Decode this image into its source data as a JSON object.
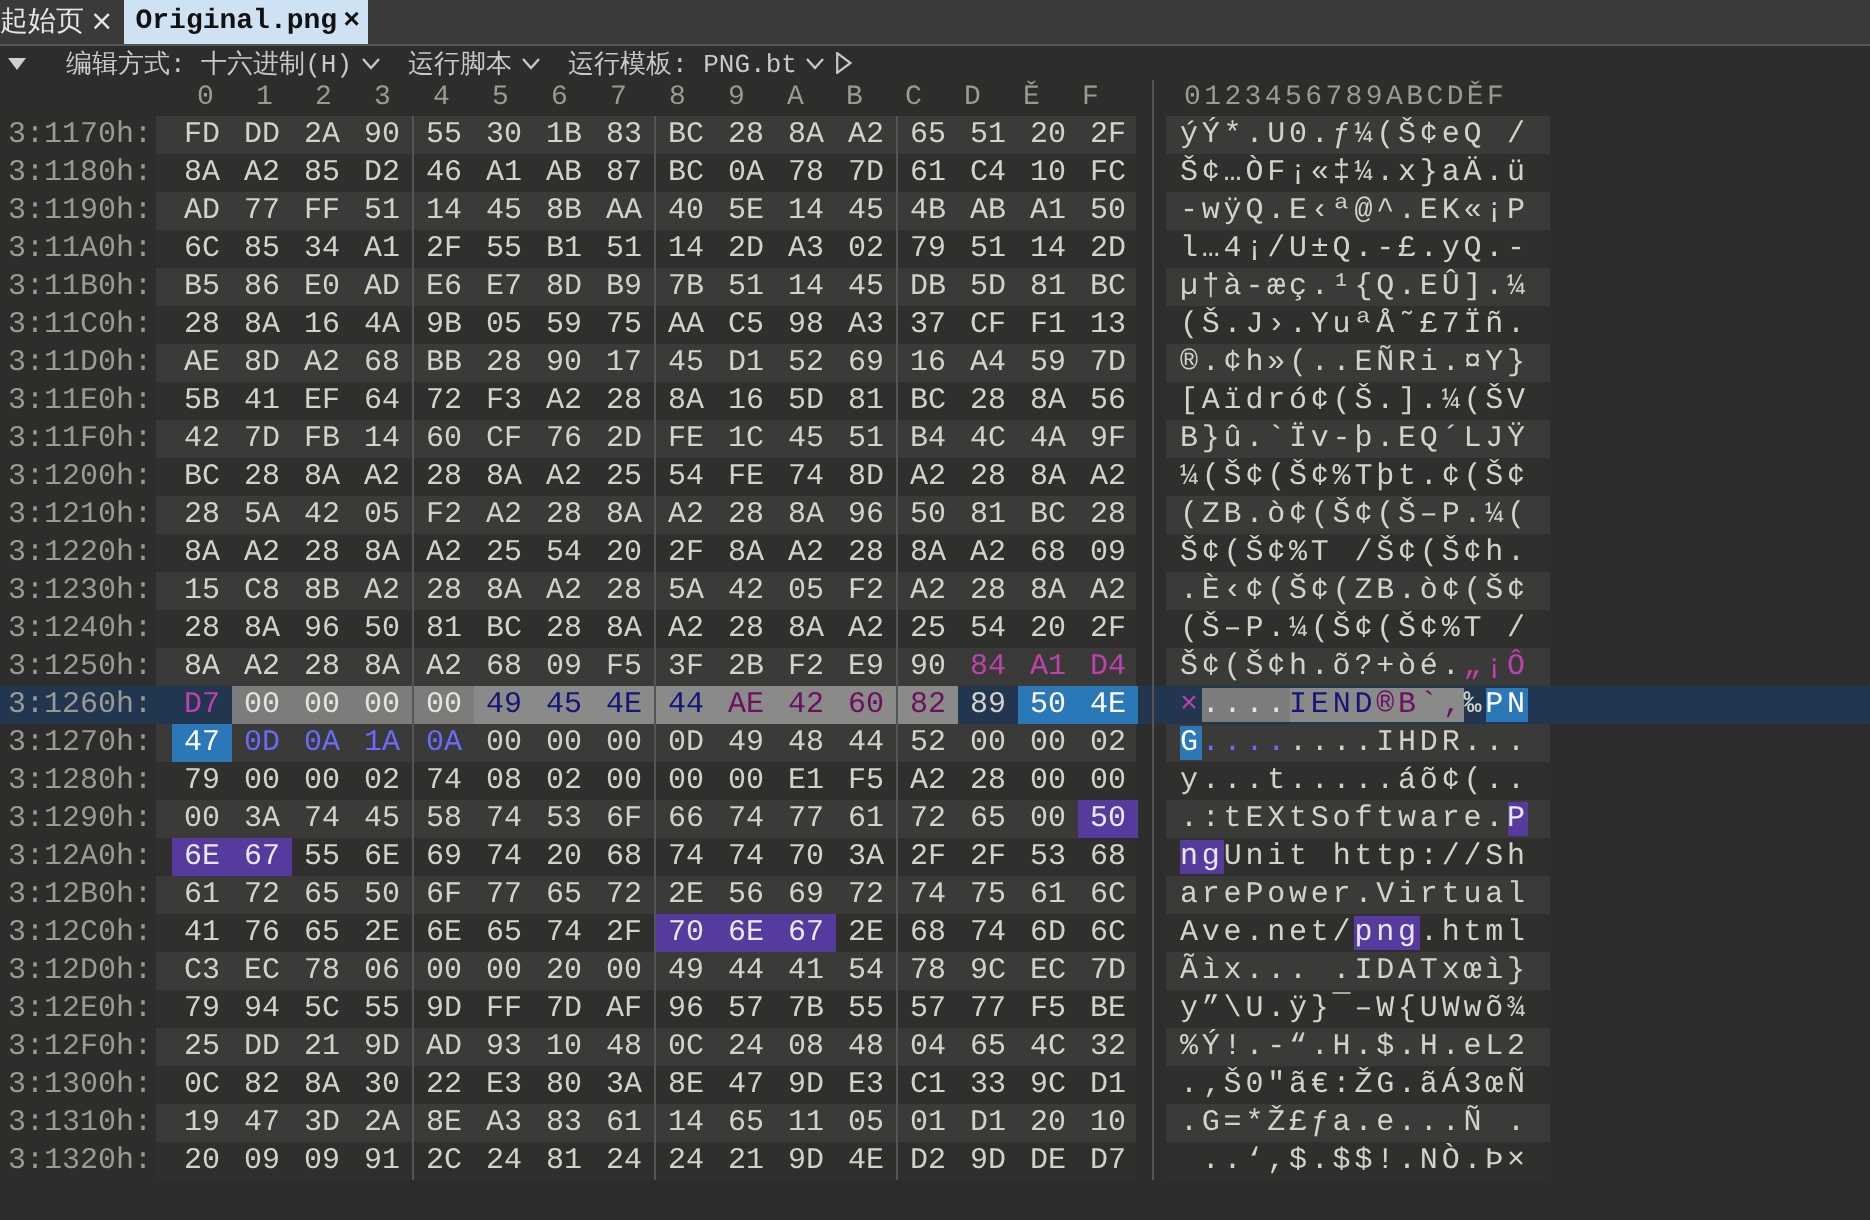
{
  "tabs": [
    {
      "label": "起始页",
      "selected": false,
      "close": "×"
    },
    {
      "label": "Original.png",
      "selected": true,
      "close": "×"
    }
  ],
  "toolbar": [
    {
      "kind": "dropdown",
      "label": "编辑方式: 十六进制(H)"
    },
    {
      "kind": "dropdown",
      "label": "运行脚本"
    },
    {
      "kind": "dropdown",
      "label": "运行模板: PNG.bt"
    },
    {
      "kind": "run"
    }
  ],
  "columns": [
    "0",
    "1",
    "2",
    "3",
    "4",
    "5",
    "6",
    "7",
    "8",
    "9",
    "A",
    "B",
    "C",
    "D",
    "Ě",
    "F"
  ],
  "ascii_header": "0123456789ABCDĚF",
  "rows": [
    {
      "address": "3:1170h:",
      "current": false,
      "hex": [
        {
          "kind": "plain",
          "bytes": [
            "FD",
            "DD",
            "2A",
            "90",
            "55",
            "30",
            "1B",
            "83",
            "BC",
            "28",
            "8A",
            "A2",
            "65",
            "51",
            "20",
            "2F"
          ]
        }
      ],
      "ascii": [
        {
          "kind": "plain",
          "text": "ýÝ*.U0.ƒ¼(Š¢eQ /"
        }
      ]
    },
    {
      "address": "3:1180h:",
      "current": false,
      "hex": [
        {
          "kind": "plain",
          "bytes": [
            "8A",
            "A2",
            "85",
            "D2",
            "46",
            "A1",
            "AB",
            "87",
            "BC",
            "0A",
            "78",
            "7D",
            "61",
            "C4",
            "10",
            "FC"
          ]
        }
      ],
      "ascii": [
        {
          "kind": "plain",
          "text": "Š¢…ÒF¡«‡¼.x}aÄ.ü"
        }
      ]
    },
    {
      "address": "3:1190h:",
      "current": false,
      "hex": [
        {
          "kind": "plain",
          "bytes": [
            "AD",
            "77",
            "FF",
            "51",
            "14",
            "45",
            "8B",
            "AA",
            "40",
            "5E",
            "14",
            "45",
            "4B",
            "AB",
            "A1",
            "50"
          ]
        }
      ],
      "ascii": [
        {
          "kind": "plain",
          "text": "-wÿQ.E‹ª@^.EK«¡P"
        }
      ]
    },
    {
      "address": "3:11A0h:",
      "current": false,
      "hex": [
        {
          "kind": "plain",
          "bytes": [
            "6C",
            "85",
            "34",
            "A1",
            "2F",
            "55",
            "B1",
            "51",
            "14",
            "2D",
            "A3",
            "02",
            "79",
            "51",
            "14",
            "2D"
          ]
        }
      ],
      "ascii": [
        {
          "kind": "plain",
          "text": "l…4¡/U±Q.-£.yQ.-"
        }
      ]
    },
    {
      "address": "3:11B0h:",
      "current": false,
      "hex": [
        {
          "kind": "plain",
          "bytes": [
            "B5",
            "86",
            "E0",
            "AD",
            "E6",
            "E7",
            "8D",
            "B9",
            "7B",
            "51",
            "14",
            "45",
            "DB",
            "5D",
            "81",
            "BC"
          ]
        }
      ],
      "ascii": [
        {
          "kind": "plain",
          "text": "µ†à-æç.¹{Q.EÛ].¼"
        }
      ]
    },
    {
      "address": "3:11C0h:",
      "current": false,
      "hex": [
        {
          "kind": "plain",
          "bytes": [
            "28",
            "8A",
            "16",
            "4A",
            "9B",
            "05",
            "59",
            "75",
            "AA",
            "C5",
            "98",
            "A3",
            "37",
            "CF",
            "F1",
            "13"
          ]
        }
      ],
      "ascii": [
        {
          "kind": "plain",
          "text": "(Š.J›.YuªÅ˜£7Ïñ."
        }
      ]
    },
    {
      "address": "3:11D0h:",
      "current": false,
      "hex": [
        {
          "kind": "plain",
          "bytes": [
            "AE",
            "8D",
            "A2",
            "68",
            "BB",
            "28",
            "90",
            "17",
            "45",
            "D1",
            "52",
            "69",
            "16",
            "A4",
            "59",
            "7D"
          ]
        }
      ],
      "ascii": [
        {
          "kind": "plain",
          "text": "®.¢h»(..EÑRi.¤Y}"
        }
      ]
    },
    {
      "address": "3:11E0h:",
      "current": false,
      "hex": [
        {
          "kind": "plain",
          "bytes": [
            "5B",
            "41",
            "EF",
            "64",
            "72",
            "F3",
            "A2",
            "28",
            "8A",
            "16",
            "5D",
            "81",
            "BC",
            "28",
            "8A",
            "56"
          ]
        }
      ],
      "ascii": [
        {
          "kind": "plain",
          "text": "[Aïdró¢(Š.].¼(ŠV"
        }
      ]
    },
    {
      "address": "3:11F0h:",
      "current": false,
      "hex": [
        {
          "kind": "plain",
          "bytes": [
            "42",
            "7D",
            "FB",
            "14",
            "60",
            "CF",
            "76",
            "2D",
            "FE",
            "1C",
            "45",
            "51",
            "B4",
            "4C",
            "4A",
            "9F"
          ]
        }
      ],
      "ascii": [
        {
          "kind": "plain",
          "text": "B}û.`Ïv-þ.EQ´LJŸ"
        }
      ]
    },
    {
      "address": "3:1200h:",
      "current": false,
      "hex": [
        {
          "kind": "plain",
          "bytes": [
            "BC",
            "28",
            "8A",
            "A2",
            "28",
            "8A",
            "A2",
            "25",
            "54",
            "FE",
            "74",
            "8D",
            "A2",
            "28",
            "8A",
            "A2"
          ]
        }
      ],
      "ascii": [
        {
          "kind": "plain",
          "text": "¼(Š¢(Š¢%Tþt.¢(Š¢"
        }
      ]
    },
    {
      "address": "3:1210h:",
      "current": false,
      "hex": [
        {
          "kind": "plain",
          "bytes": [
            "28",
            "5A",
            "42",
            "05",
            "F2",
            "A2",
            "28",
            "8A",
            "A2",
            "28",
            "8A",
            "96",
            "50",
            "81",
            "BC",
            "28"
          ]
        }
      ],
      "ascii": [
        {
          "kind": "plain",
          "text": "(ZB.ò¢(Š¢(Š–P.¼("
        }
      ]
    },
    {
      "address": "3:1220h:",
      "current": false,
      "hex": [
        {
          "kind": "plain",
          "bytes": [
            "8A",
            "A2",
            "28",
            "8A",
            "A2",
            "25",
            "54",
            "20",
            "2F",
            "8A",
            "A2",
            "28",
            "8A",
            "A2",
            "68",
            "09"
          ]
        }
      ],
      "ascii": [
        {
          "kind": "plain",
          "text": "Š¢(Š¢%T /Š¢(Š¢h."
        }
      ]
    },
    {
      "address": "3:1230h:",
      "current": false,
      "hex": [
        {
          "kind": "plain",
          "bytes": [
            "15",
            "C8",
            "8B",
            "A2",
            "28",
            "8A",
            "A2",
            "28",
            "5A",
            "42",
            "05",
            "F2",
            "A2",
            "28",
            "8A",
            "A2"
          ]
        }
      ],
      "ascii": [
        {
          "kind": "plain",
          "text": ".È‹¢(Š¢(ZB.ò¢(Š¢"
        }
      ]
    },
    {
      "address": "3:1240h:",
      "current": false,
      "hex": [
        {
          "kind": "plain",
          "bytes": [
            "28",
            "8A",
            "96",
            "50",
            "81",
            "BC",
            "28",
            "8A",
            "A2",
            "28",
            "8A",
            "A2",
            "25",
            "54",
            "20",
            "2F"
          ]
        }
      ],
      "ascii": [
        {
          "kind": "plain",
          "text": "(Š–P.¼(Š¢(Š¢%T /"
        }
      ]
    },
    {
      "address": "3:1250h:",
      "current": false,
      "hex": [
        {
          "kind": "plain",
          "bytes": [
            "8A",
            "A2",
            "28",
            "8A",
            "A2",
            "68",
            "09",
            "F5",
            "3F",
            "2B",
            "F2",
            "E9",
            "90"
          ]
        },
        {
          "kind": "magenta",
          "bytes": [
            "84",
            "A1",
            "D4"
          ]
        }
      ],
      "ascii": [
        {
          "kind": "plain",
          "text": "Š¢(Š¢h.õ?+òé."
        },
        {
          "kind": "magenta",
          "text": "„¡Ô"
        }
      ]
    },
    {
      "address": "3:1260h:",
      "current": true,
      "hex": [
        {
          "kind": "magenta",
          "bytes": [
            "D7"
          ]
        },
        {
          "kind": "selection",
          "bytes": [
            "00",
            "00",
            "00",
            "00"
          ]
        },
        {
          "kind": "selection-navy",
          "bytes": [
            "49",
            "45",
            "4E",
            "44"
          ]
        },
        {
          "kind": "selection-magenta",
          "bytes": [
            "AE",
            "42",
            "60",
            "82"
          ]
        },
        {
          "kind": "plain",
          "bytes": [
            "89"
          ]
        },
        {
          "kind": "cursor",
          "bytes": [
            "50",
            "4E"
          ]
        }
      ],
      "ascii": [
        {
          "kind": "magenta",
          "text": "×"
        },
        {
          "kind": "selection",
          "text": "...."
        },
        {
          "kind": "selection-navy",
          "text": "IEND"
        },
        {
          "kind": "selection-magenta",
          "text": "®B`‚"
        },
        {
          "kind": "plain",
          "text": "‰"
        },
        {
          "kind": "cursor",
          "text": "PN"
        }
      ]
    },
    {
      "address": "3:1270h:",
      "current": false,
      "hex": [
        {
          "kind": "cursor",
          "bytes": [
            "47"
          ]
        },
        {
          "kind": "navy",
          "bytes": [
            "0D",
            "0A",
            "1A",
            "0A"
          ]
        },
        {
          "kind": "plain",
          "bytes": [
            "00",
            "00",
            "00",
            "0D",
            "49",
            "48",
            "44",
            "52",
            "00",
            "00",
            "02"
          ]
        }
      ],
      "ascii": [
        {
          "kind": "cursor",
          "text": "G"
        },
        {
          "kind": "navy",
          "text": "...."
        },
        {
          "kind": "plain",
          "text": "....IHDR..."
        }
      ]
    },
    {
      "address": "3:1280h:",
      "current": false,
      "hex": [
        {
          "kind": "plain",
          "bytes": [
            "79",
            "00",
            "00",
            "02",
            "74",
            "08",
            "02",
            "00",
            "00",
            "00",
            "E1",
            "F5",
            "A2",
            "28",
            "00",
            "00"
          ]
        }
      ],
      "ascii": [
        {
          "kind": "plain",
          "text": "y...t.....áõ¢(.."
        }
      ]
    },
    {
      "address": "3:1290h:",
      "current": false,
      "hex": [
        {
          "kind": "plain",
          "bytes": [
            "00",
            "3A",
            "74",
            "45",
            "58",
            "74",
            "53",
            "6F",
            "66",
            "74",
            "77",
            "61",
            "72",
            "65",
            "00"
          ]
        },
        {
          "kind": "match",
          "bytes": [
            "50"
          ]
        }
      ],
      "ascii": [
        {
          "kind": "plain",
          "text": ".:tEXtSoftware."
        },
        {
          "kind": "match",
          "text": "P"
        }
      ]
    },
    {
      "address": "3:12A0h:",
      "current": false,
      "hex": [
        {
          "kind": "match",
          "bytes": [
            "6E",
            "67"
          ]
        },
        {
          "kind": "plain",
          "bytes": [
            "55",
            "6E",
            "69",
            "74",
            "20",
            "68",
            "74",
            "74",
            "70",
            "3A",
            "2F",
            "2F",
            "53",
            "68"
          ]
        }
      ],
      "ascii": [
        {
          "kind": "match",
          "text": "ng"
        },
        {
          "kind": "plain",
          "text": "Unit http://Sh"
        }
      ]
    },
    {
      "address": "3:12B0h:",
      "current": false,
      "hex": [
        {
          "kind": "plain",
          "bytes": [
            "61",
            "72",
            "65",
            "50",
            "6F",
            "77",
            "65",
            "72",
            "2E",
            "56",
            "69",
            "72",
            "74",
            "75",
            "61",
            "6C"
          ]
        }
      ],
      "ascii": [
        {
          "kind": "plain",
          "text": "arePower.Virtual"
        }
      ]
    },
    {
      "address": "3:12C0h:",
      "current": false,
      "hex": [
        {
          "kind": "plain",
          "bytes": [
            "41",
            "76",
            "65",
            "2E",
            "6E",
            "65",
            "74",
            "2F"
          ]
        },
        {
          "kind": "match",
          "bytes": [
            "70",
            "6E",
            "67"
          ]
        },
        {
          "kind": "plain",
          "bytes": [
            "2E",
            "68",
            "74",
            "6D",
            "6C"
          ]
        }
      ],
      "ascii": [
        {
          "kind": "plain",
          "text": "Ave.net/"
        },
        {
          "kind": "match",
          "text": "png"
        },
        {
          "kind": "plain",
          "text": ".html"
        }
      ]
    },
    {
      "address": "3:12D0h:",
      "current": false,
      "hex": [
        {
          "kind": "plain",
          "bytes": [
            "C3",
            "EC",
            "78",
            "06",
            "00",
            "00",
            "20",
            "00",
            "49",
            "44",
            "41",
            "54",
            "78",
            "9C",
            "EC",
            "7D"
          ]
        }
      ],
      "ascii": [
        {
          "kind": "plain",
          "text": "Ãìx... .IDATxœì}"
        }
      ]
    },
    {
      "address": "3:12E0h:",
      "current": false,
      "hex": [
        {
          "kind": "plain",
          "bytes": [
            "79",
            "94",
            "5C",
            "55",
            "9D",
            "FF",
            "7D",
            "AF",
            "96",
            "57",
            "7B",
            "55",
            "57",
            "77",
            "F5",
            "BE"
          ]
        }
      ],
      "ascii": [
        {
          "kind": "plain",
          "text": "y”\\U.ÿ}¯–W{UWwõ¾"
        }
      ]
    },
    {
      "address": "3:12F0h:",
      "current": false,
      "hex": [
        {
          "kind": "plain",
          "bytes": [
            "25",
            "DD",
            "21",
            "9D",
            "AD",
            "93",
            "10",
            "48",
            "0C",
            "24",
            "08",
            "48",
            "04",
            "65",
            "4C",
            "32"
          ]
        }
      ],
      "ascii": [
        {
          "kind": "plain",
          "text": "%Ý!.-“.H.$.H.eL2"
        }
      ]
    },
    {
      "address": "3:1300h:",
      "current": false,
      "hex": [
        {
          "kind": "plain",
          "bytes": [
            "0C",
            "82",
            "8A",
            "30",
            "22",
            "E3",
            "80",
            "3A",
            "8E",
            "47",
            "9D",
            "E3",
            "C1",
            "33",
            "9C",
            "D1"
          ]
        }
      ],
      "ascii": [
        {
          "kind": "plain",
          "text": ".‚Š0\"ã€:ŽG.ãÁ3œÑ"
        }
      ]
    },
    {
      "address": "3:1310h:",
      "current": false,
      "hex": [
        {
          "kind": "plain",
          "bytes": [
            "19",
            "47",
            "3D",
            "2A",
            "8E",
            "A3",
            "83",
            "61",
            "14",
            "65",
            "11",
            "05",
            "01",
            "D1",
            "20",
            "10"
          ]
        }
      ],
      "ascii": [
        {
          "kind": "plain",
          "text": ".G=*Ž£ƒa.e...Ñ ."
        }
      ]
    },
    {
      "address": "3:1320h:",
      "current": false,
      "hex": [
        {
          "kind": "plain",
          "bytes": [
            "20",
            "09",
            "09",
            "91",
            "2C",
            "24",
            "81",
            "24",
            "24",
            "21",
            "9D",
            "4E",
            "D2",
            "9D",
            "DE",
            "D7"
          ]
        }
      ],
      "ascii": [
        {
          "kind": "plain",
          "text": " ..‘,$.$$!.NÒ.Þ×"
        }
      ]
    }
  ]
}
